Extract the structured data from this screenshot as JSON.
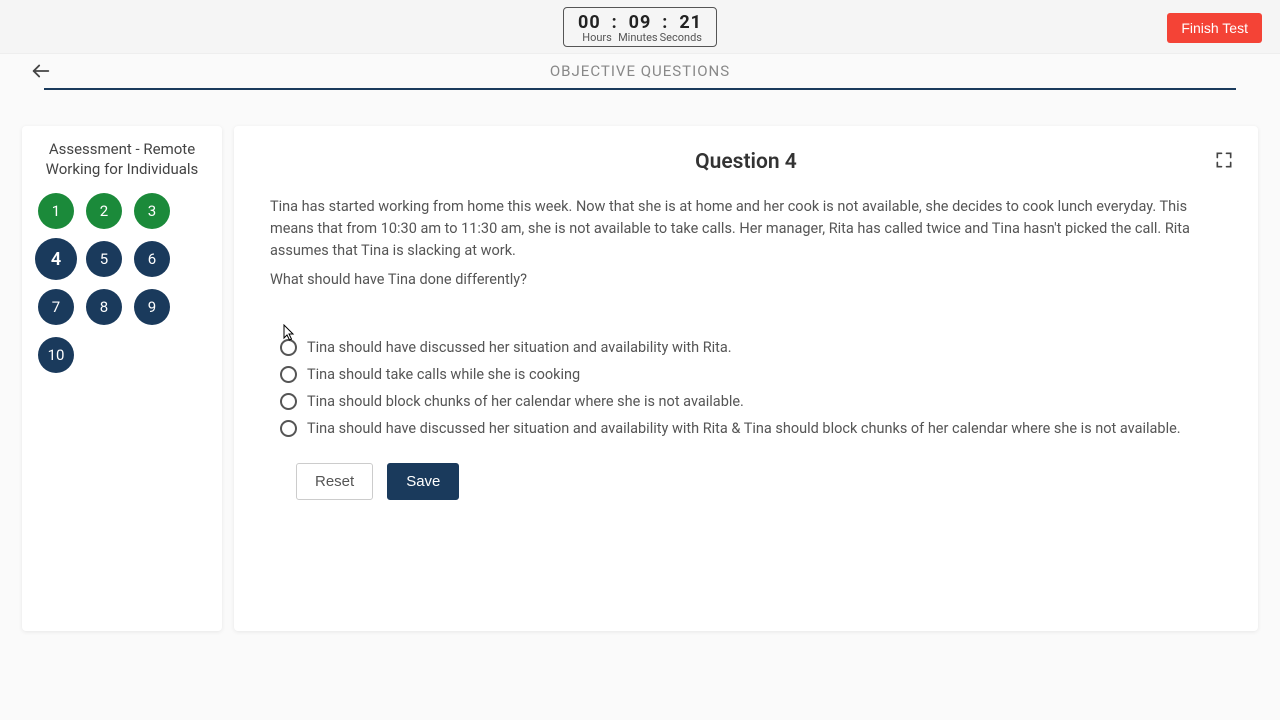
{
  "timer": {
    "hours": "00",
    "minutes": "09",
    "seconds": "21",
    "sep": ":",
    "label_hours": "Hours",
    "label_minutes": "Minutes",
    "label_seconds": "Seconds"
  },
  "finish_label": "Finish Test",
  "section_title": "OBJECTIVE QUESTIONS",
  "sidebar": {
    "title": "Assessment - Remote Working for Individuals",
    "questions": [
      {
        "num": "1",
        "state": "completed"
      },
      {
        "num": "2",
        "state": "completed"
      },
      {
        "num": "3",
        "state": "completed"
      },
      {
        "num": "4",
        "state": "current"
      },
      {
        "num": "5",
        "state": "pending"
      },
      {
        "num": "6",
        "state": "pending"
      },
      {
        "num": "7",
        "state": "pending"
      },
      {
        "num": "8",
        "state": "pending"
      },
      {
        "num": "9",
        "state": "pending"
      },
      {
        "num": "10",
        "state": "pending"
      }
    ]
  },
  "question": {
    "heading": "Question 4",
    "body": "Tina has started working from home this week. Now that she is at home and her cook is not available, she decides to cook lunch everyday. This means that from 10:30 am to 11:30 am, she is not available to take calls. Her manager, Rita has called twice and Tina hasn't picked the call. Rita assumes that Tina is slacking at work.",
    "prompt": "What should have Tina done differently?",
    "options": [
      "Tina should have discussed her situation and availability with Rita.",
      "Tina should take calls while she is cooking",
      "Tina should block chunks of her calendar where she is not available.",
      "Tina should have discussed her situation and availability with Rita & Tina should block chunks of her calendar where she is not available."
    ]
  },
  "actions": {
    "reset": "Reset",
    "save": "Save"
  }
}
